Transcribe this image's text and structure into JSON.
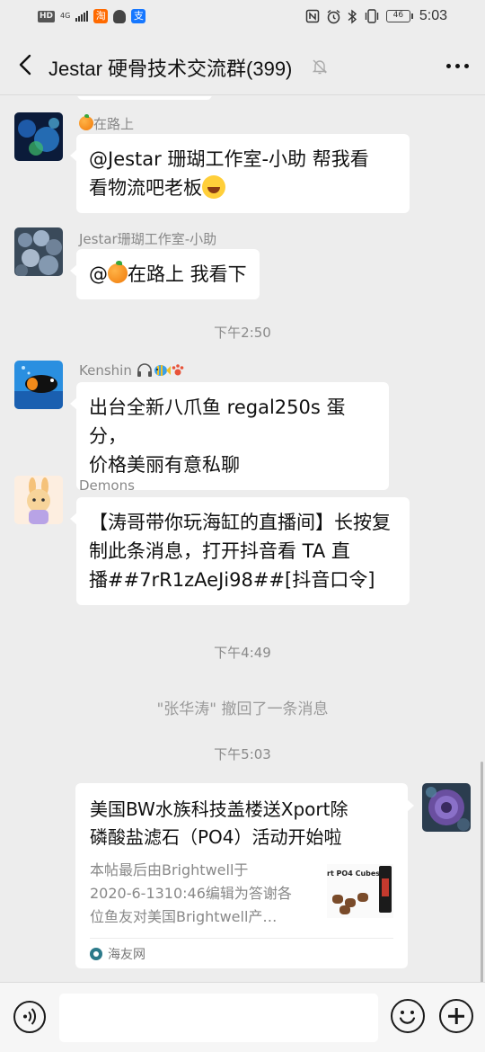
{
  "status_bar": {
    "hd": "HD",
    "network": "4G",
    "taobao_glyph": "淘",
    "alipay_glyph": "支",
    "battery": "46",
    "time": "5:03",
    "icons": [
      "nfc-icon",
      "alarm-icon",
      "bluetooth-icon",
      "vibrate-icon"
    ]
  },
  "nav": {
    "title": "Jestar 硬骨技术交流群(399)",
    "muted": true
  },
  "messages": [
    {
      "sender": "在路上",
      "sender_emoji": "orange-emoji",
      "text_parts": [
        "@Jestar 珊瑚工作室-小助   帮我看",
        "看物流吧老板"
      ],
      "emoji": "laughing-tears-emoji"
    },
    {
      "sender": "Jestar珊瑚工作室-小助",
      "text_prefix": "@",
      "text_suffix": "在路上   我看下"
    },
    {
      "sender": "Kenshin",
      "sender_emojis": [
        "headphones-emoji",
        "tropical-fish-emoji",
        "paw-prints-emoji"
      ],
      "text_lines": [
        "出台全新八爪鱼 regal250s 蛋分，",
        "价格美丽有意私聊"
      ]
    },
    {
      "sender": "Demons",
      "text_lines": [
        "【涛哥带你玩海缸的直播间】长按复",
        "制此条消息，打开抖音看 TA 直",
        "播##7rR1zAeJi98##[抖音口令]"
      ]
    }
  ],
  "time_labels": [
    "下午2:50",
    "下午4:49",
    "下午5:03"
  ],
  "recall_note": "\"张华涛\" 撤回了一条消息",
  "link_card": {
    "title": "美国BW水族科技盖楼送Xport除磷酸盐滤石（PO4）活动开始啦",
    "title_lines": [
      "美国BW水族科技盖楼送Xport除",
      "磷酸盐滤石（PO4）活动开始啦"
    ],
    "desc_lines": [
      "本帖最后由Brightwell于",
      "2020-6-1310:46编辑为答谢各",
      "位鱼友对美国Brightwell产…"
    ],
    "thumb_text": "rt PO4 Cubes",
    "source": "海友网"
  },
  "input": {
    "placeholder": ""
  }
}
